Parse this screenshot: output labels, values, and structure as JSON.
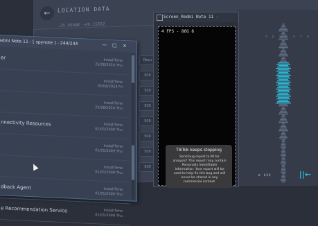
{
  "location_tool": {
    "back_icon": "arrow-left-icon",
    "title": "LOCATION DATA",
    "coords": "-25.45ANK  -49.15032"
  },
  "phone_window": {
    "title": "Screen_Redmi Note 11 -",
    "fps": "4 FPS - 86G 8",
    "dialog": {
      "title": "TikTok keeps stopping",
      "body": "Send bug report to Mi for analysis? This report may contain Personally Identifiable Information. Your report will be used to help fix this bug and will never be shared in any commercial context."
    }
  },
  "list_window": {
    "title": "edmi Note 11 - [ spynote ] - 244/244",
    "controls": [
      "—",
      "□",
      "×"
    ],
    "rows": [
      {
        "name": "er",
        "type": "InstallTime",
        "date": "25/08/2024 Thu"
      },
      {
        "name": "",
        "type": "InstallTime",
        "date": "05/08/2024 Fri"
      },
      {
        "name": "",
        "type": "InstallTime",
        "date": "25/08/2024 Thu"
      },
      {
        "name": "nnectivity Resources",
        "type": "InstallTime",
        "date": "01/01/2009 Thu"
      },
      {
        "name": "",
        "type": "InstallTime",
        "date": "01/01/2009 Thu"
      },
      {
        "name": "",
        "type": "InstallTime",
        "date": "01/01/2009 Thu"
      },
      {
        "name": "dback Agent",
        "type": "InstallTime",
        "date": "01/01/2009 Thu"
      },
      {
        "name": "e Recommendation Service",
        "type": "InstallTime",
        "date": "01/01/2009 Thu"
      }
    ]
  },
  "mid_buttons": [
    "Resu",
    "500",
    "500",
    "500",
    "500",
    "500",
    "500",
    "500"
  ],
  "waveform": {
    "label": "s p y n o t e",
    "footer": "▶   ▮▮▮",
    "logo": "||←",
    "accent": "#2fb8d6"
  }
}
